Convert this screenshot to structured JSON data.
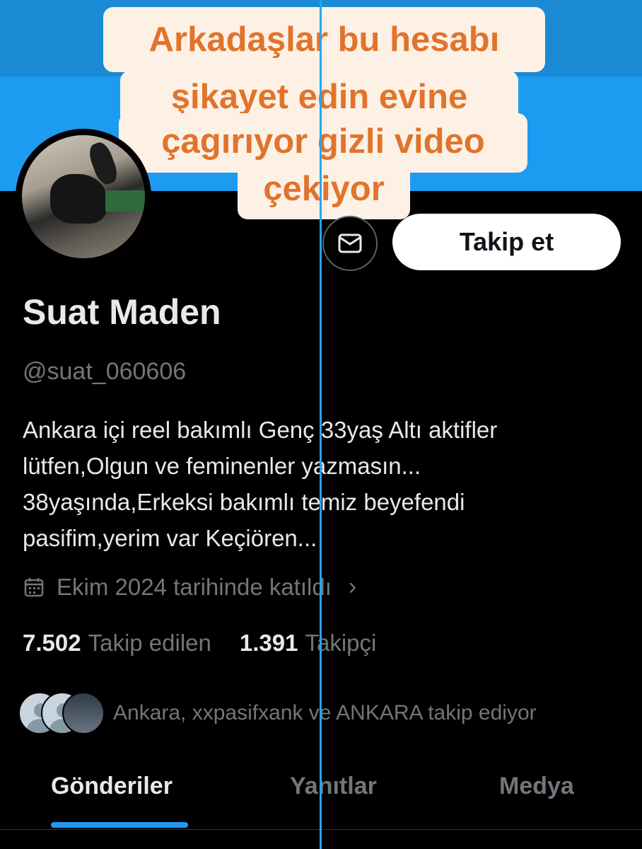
{
  "caption": {
    "lines": [
      "Arkadaşlar bu hesabı",
      "şikayet edin evine",
      "çagırıyor gizli video",
      "çekiyor"
    ]
  },
  "profile": {
    "name": "Suat Maden",
    "handle": "@suat_060606",
    "bio_lines": [
      "Ankara içi reel bakımlı Genç 33yaş Altı aktifler",
      "lütfen,Olgun ve feminenler yazmasın...",
      "38yaşında,Erkeksi bakımlı temiz beyefendi",
      "pasifim,yerim var Keçiören..."
    ],
    "joined": "Ekim 2024 tarihinde katıldı",
    "following_count": "7.502",
    "following_label": "Takip edilen",
    "followers_count": "1.391",
    "followers_label": "Takipçi",
    "followed_by": "Ankara, xxpasifxank ve ANKARA takip ediyor"
  },
  "actions": {
    "follow_label": "Takip et",
    "message_icon": "mail-icon"
  },
  "tabs": [
    {
      "label": "Gönderiler",
      "active": true
    },
    {
      "label": "Yanıtlar",
      "active": false
    },
    {
      "label": "Medya",
      "active": false
    }
  ],
  "colors": {
    "banner": "#1d9bf0",
    "background": "#000000",
    "caption_text": "#e0742c",
    "caption_bg": "#fdf1e6",
    "accent": "#1d9bf0"
  }
}
